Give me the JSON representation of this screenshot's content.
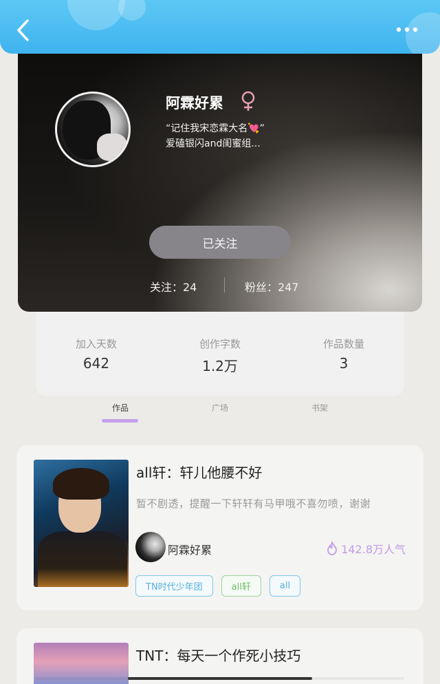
{
  "header": {
    "back_icon": "chevron-left-icon",
    "more_icon": "more-dots-icon"
  },
  "profile": {
    "username": "阿霖好累",
    "gender_icon": "female-symbol-icon",
    "bio_line1": "“记住我宋恋霖大名💘”",
    "bio_line2": "爱磕银闪and闺蜜组...",
    "follow_label": "已关注",
    "following_label": "关注：24",
    "fans_label": "粉丝：247"
  },
  "stats": [
    {
      "label": "加入天数",
      "value": "642"
    },
    {
      "label": "创作字数",
      "value": "1.2万"
    },
    {
      "label": "作品数量",
      "value": "3"
    }
  ],
  "tabs": [
    {
      "label": "作品",
      "active": true
    },
    {
      "label": "广场",
      "active": false
    },
    {
      "label": "书架",
      "active": false
    }
  ],
  "works": [
    {
      "title": "all轩：轩儿他腰不好",
      "summary": "暂不剧透，提醒一下轩轩有马甲哦不喜勿喷，谢谢",
      "author": "阿霖好累",
      "popularity": "142.8万人气",
      "tags": [
        "TN时代少年团",
        "all轩",
        "all"
      ]
    },
    {
      "title": "TNT：每天一个作死小技巧"
    }
  ],
  "colors": {
    "header_blue": "#3fb3ef",
    "accent_purple": "#c39be3",
    "tag_blue": "#56b2da",
    "tag_green": "#6cbd6c",
    "gender_pink": "#e8a0b4"
  }
}
